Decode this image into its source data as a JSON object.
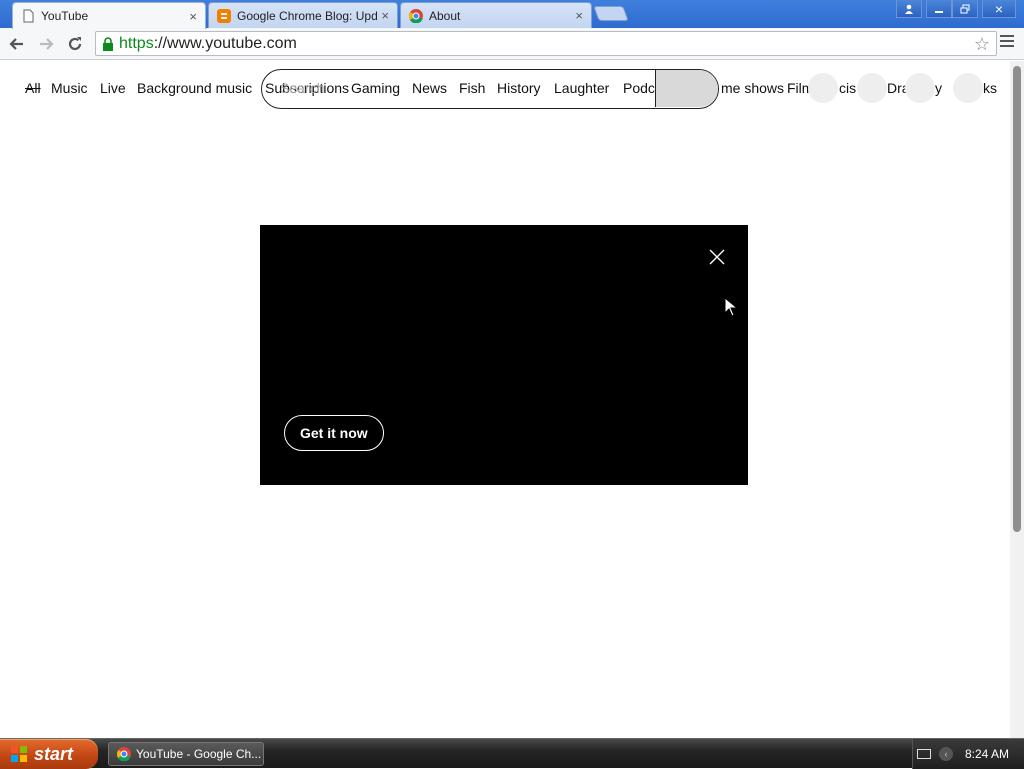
{
  "browser": {
    "tabs": [
      {
        "title": "YouTube",
        "icon": "page-icon",
        "active": true
      },
      {
        "title": "Google Chrome Blog: Update",
        "icon": "blogger-icon",
        "active": false
      },
      {
        "title": "About",
        "icon": "chrome-icon",
        "active": false
      }
    ],
    "tab_close_glyph": "×",
    "url": {
      "scheme": "https",
      "rest": "://www.youtube.com"
    },
    "window_buttons": {
      "profile": "person-icon",
      "minimize": "minimize-icon",
      "restore": "restore-icon",
      "close": "×"
    }
  },
  "youtube": {
    "chips": [
      "All",
      "Music",
      "Live",
      "Background music",
      "Subscriptions",
      "Gaming",
      "News",
      "Fish",
      "History",
      "Laughter",
      "Podcasts",
      "Game shows",
      "Film",
      "Musicals",
      "Drama",
      "Comedy",
      "Books"
    ],
    "chips_visible": [
      "All",
      "Music",
      "Live",
      "Background music",
      "Subscriptions",
      "Gaming",
      "News",
      "Fish",
      "History",
      "Laughter",
      "Podc",
      "me shows",
      "Film",
      "cis",
      "Dra",
      "y",
      "ks"
    ],
    "search_placeholder": "Search"
  },
  "modal": {
    "cta_label": "Get it now",
    "close_icon": "close-icon"
  },
  "taskbar": {
    "start_label": "start",
    "task_label": "YouTube - Google Ch...",
    "clock": "8:24 AM"
  }
}
